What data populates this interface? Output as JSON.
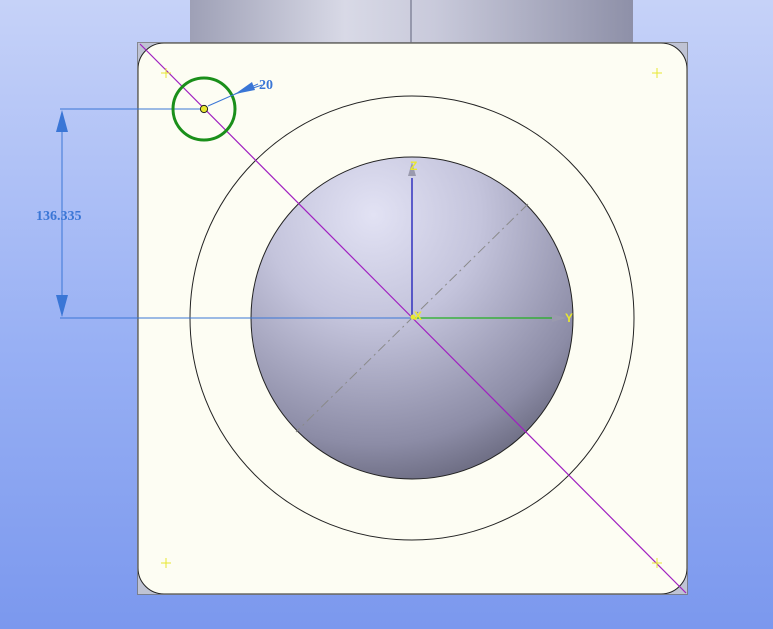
{
  "model_view": {
    "dimensions": {
      "vertical_distance": "136.335",
      "circle_diameter": "20"
    },
    "triad": {
      "x_label": "X",
      "y_label": "Y",
      "z_label": "Z"
    },
    "colors": {
      "background_top": "#c6d2f8",
      "background_bottom": "#7b98ee",
      "plate_fill": "#fdfdf3",
      "dimension_color": "#3a76d6",
      "selected_circle": "#1a8f1a",
      "diagonal_line": "#a020c0",
      "x_axis": "#2a8a2a",
      "y_axis": "#22b022",
      "z_axis": "#1a1ab8",
      "sketch_point": "#e8e830"
    }
  }
}
